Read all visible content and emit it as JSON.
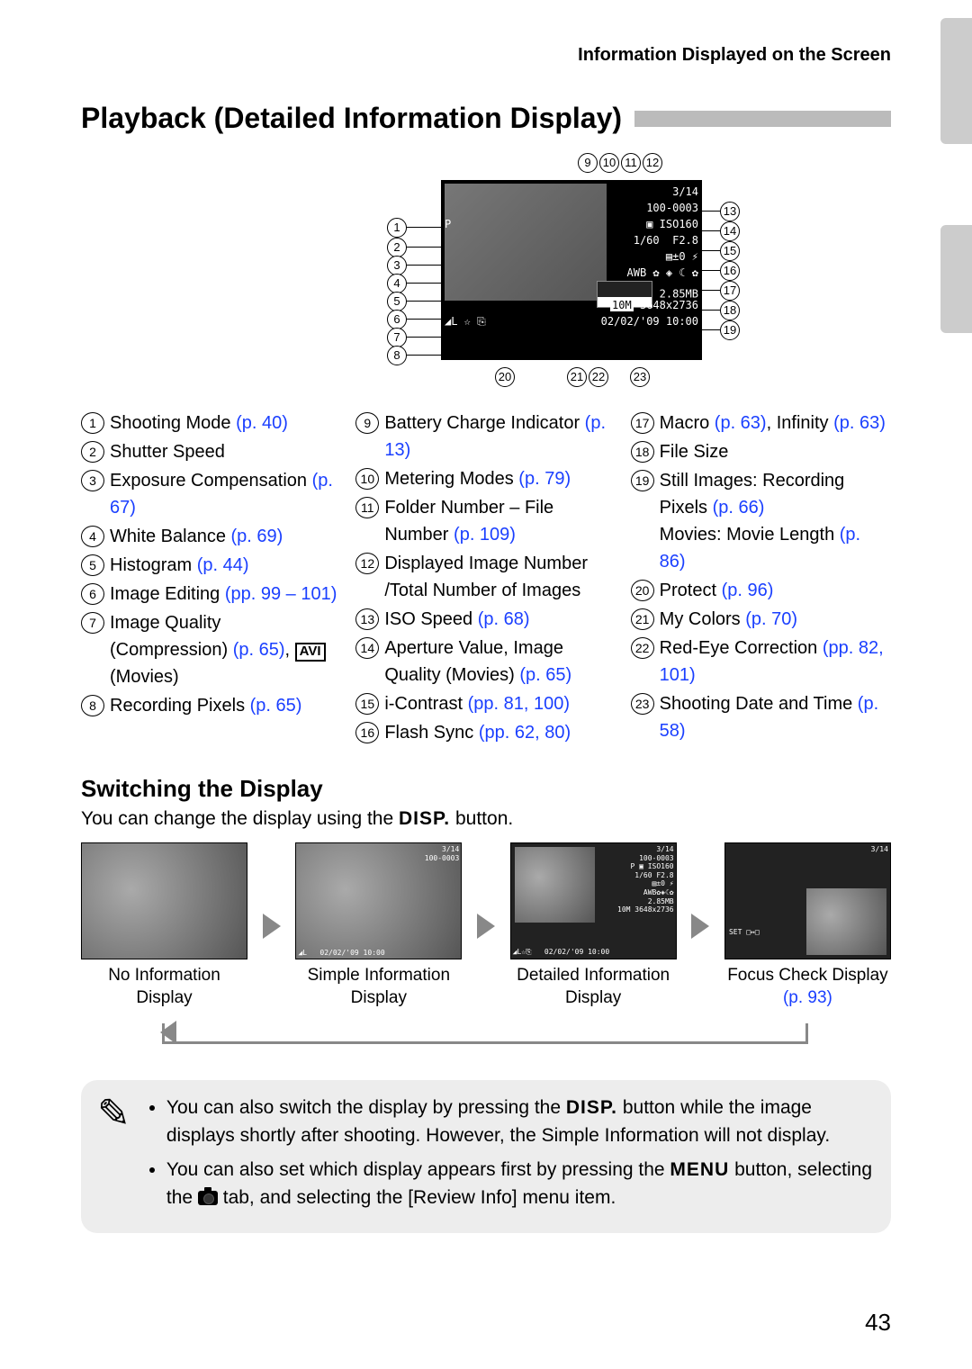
{
  "header": "Information Displayed on the Screen",
  "title": "Playback (Detailed Information Display)",
  "diagram": {
    "top_callouts": [
      "9",
      "10",
      "11",
      "12"
    ],
    "left_callouts": [
      "1",
      "2",
      "3",
      "4",
      "5",
      "6",
      "7",
      "8"
    ],
    "right_callouts": [
      "13",
      "14",
      "15",
      "16",
      "17",
      "18",
      "19"
    ],
    "bottom_callouts_left": "20",
    "bottom_callouts_mid": [
      "21",
      "22"
    ],
    "bottom_callouts_right": "23",
    "screen": {
      "count": "3/14",
      "folder": "100-0003",
      "line_p": "P",
      "iso": "ISO160",
      "shutter": "1/60",
      "aperture": "F2.8",
      "ev": "±0",
      "wb_icons": "AWB",
      "size": "2.85MB",
      "res_tag": "10M",
      "res": "3648x2736",
      "quality": "◢L",
      "date": "02/02/'09  10:00"
    }
  },
  "legend": {
    "col1": [
      {
        "n": "1",
        "text": "Shooting Mode ",
        "ref": "(p. 40)"
      },
      {
        "n": "2",
        "text": "Shutter Speed",
        "ref": ""
      },
      {
        "n": "3",
        "text": "Exposure Compensation ",
        "ref": "(p. 67)"
      },
      {
        "n": "4",
        "text": "White Balance ",
        "ref": "(p. 69)"
      },
      {
        "n": "5",
        "text": "Histogram ",
        "ref": "(p. 44)"
      },
      {
        "n": "6",
        "text": "Image Editing ",
        "ref": "(pp. 99 – 101)"
      },
      {
        "n": "7",
        "text": "Image Quality (Compression) ",
        "ref": "(p. 65)",
        "tail": ", ",
        "avi": "AVI",
        "tail2": " (Movies)"
      },
      {
        "n": "8",
        "text": "Recording Pixels ",
        "ref": "(p. 65)"
      }
    ],
    "col2": [
      {
        "n": "9",
        "text": "Battery Charge Indicator ",
        "ref": "(p. 13)"
      },
      {
        "n": "10",
        "text": "Metering Modes ",
        "ref": "(p. 79)"
      },
      {
        "n": "11",
        "text": "Folder Number – File Number ",
        "ref": "(p. 109)"
      },
      {
        "n": "12",
        "text": "Displayed Image Number /Total Number of Images",
        "ref": ""
      },
      {
        "n": "13",
        "text": "ISO Speed ",
        "ref": "(p. 68)"
      },
      {
        "n": "14",
        "text": "Aperture Value, Image Quality (Movies) ",
        "ref": "(p. 65)"
      },
      {
        "n": "15",
        "text": "i-Contrast ",
        "ref": "(pp. 81, 100)"
      },
      {
        "n": "16",
        "text": "Flash Sync ",
        "ref": "(pp. 62, 80)"
      }
    ],
    "col3": [
      {
        "n": "17",
        "text": "Macro ",
        "ref": "(p. 63)",
        "tail": ", Infinity ",
        "ref2": "(p. 63)"
      },
      {
        "n": "18",
        "text": "File Size",
        "ref": ""
      },
      {
        "n": "19",
        "text": "Still Images: Recording Pixels ",
        "ref": "(p. 66)",
        "br": true,
        "text2": "Movies: Movie Length ",
        "ref2": "(p. 86)"
      },
      {
        "n": "20",
        "text": "Protect ",
        "ref": "(p. 96)"
      },
      {
        "n": "21",
        "text": "My Colors ",
        "ref": "(p. 70)"
      },
      {
        "n": "22",
        "text": "Red-Eye Correction ",
        "ref": "(pp. 82, 101)"
      },
      {
        "n": "23",
        "text": "Shooting Date and Time ",
        "ref": "(p. 58)"
      }
    ]
  },
  "switching": {
    "heading": "Switching the Display",
    "line_a": "You can change the display using the ",
    "disp": "DISP.",
    "line_b": " button.",
    "thumbs": [
      {
        "cap": "No Information Display"
      },
      {
        "cap": "Simple Information Display"
      },
      {
        "cap": "Detailed Information Display"
      },
      {
        "cap": "Focus Check Display ",
        "ref": "(p. 93)"
      }
    ]
  },
  "note": {
    "bullet1a": "You can also switch the display by pressing the ",
    "bullet1b": " button while the image displays shortly after shooting. However, the Simple Information will not display.",
    "bullet2a": "You can also set which display appears first by pressing the ",
    "menu": "MENU",
    "bullet2b": " button, selecting the ",
    "bullet2c": " tab, and selecting the [Review Info] menu item."
  },
  "page_number": "43"
}
